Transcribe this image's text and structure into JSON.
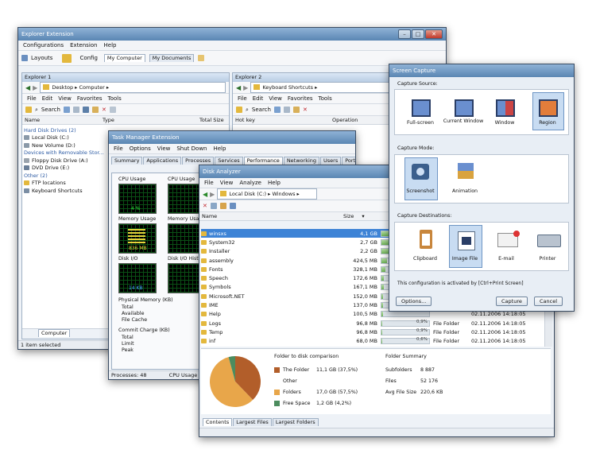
{
  "explorer": {
    "title": "Explorer Extension",
    "menu": [
      "Configurations",
      "Extension",
      "Help"
    ],
    "toolbar": {
      "layouts": "Layouts",
      "config": "Config",
      "tabs": [
        "My Computer",
        "My Documents"
      ]
    },
    "pane1": {
      "title": "Explorer 1",
      "address": "Desktop ▸ Computer ▸",
      "menu": [
        "File",
        "Edit",
        "View",
        "Favorites",
        "Tools"
      ],
      "search": "Search",
      "columns": [
        "Name",
        "Type",
        "Total Size"
      ],
      "items": [
        {
          "label": "Hard Disk Drives (2)",
          "kind": "group"
        },
        {
          "label": "Local Disk (C:)",
          "kind": "item"
        },
        {
          "label": "New Volume (D:)",
          "kind": "item"
        },
        {
          "label": "Devices with Removable Stor...",
          "kind": "group"
        },
        {
          "label": "Floppy Disk Drive (A:)",
          "kind": "item"
        },
        {
          "label": "DVD Drive (E:)",
          "kind": "item"
        },
        {
          "label": "Other (2)",
          "kind": "group"
        },
        {
          "label": "FTP locations",
          "kind": "item"
        },
        {
          "label": "Keyboard Shortcuts",
          "kind": "item"
        }
      ],
      "bottom_tab": "Computer"
    },
    "pane2": {
      "title": "Explorer 2",
      "address": "Keyboard Shortcuts ▸",
      "menu": [
        "File",
        "Edit",
        "View",
        "Favorites",
        "Tools"
      ],
      "search": "Search",
      "columns": [
        "Hot key",
        "Operation"
      ]
    },
    "status": "1 item selected"
  },
  "taskmgr": {
    "title": "Task Manager Extension",
    "menu": [
      "File",
      "Options",
      "View",
      "Shut Down",
      "Help"
    ],
    "tabs": [
      "Summary",
      "Applications",
      "Processes",
      "Services",
      "Performance",
      "Networking",
      "Users",
      "Ports"
    ],
    "active_tab": "Performance",
    "cpu_usage_label": "CPU Usage",
    "cpu_history_label": "CPU Usage",
    "cpu_value": "4 %",
    "mem_usage_label": "Memory Usage",
    "mem_history_label": "Memory Usage",
    "mem_value": "836 MB",
    "disk_io_label": "Disk I/O",
    "disk_history_label": "Disk I/O Histo",
    "disk_value": "14 KB",
    "physical_memory_label": "Physical Memory (KB)",
    "physical_rows": [
      "Total",
      "Available",
      "File Cache"
    ],
    "commit_label": "Commit Charge (KB)",
    "commit_rows": [
      "Total",
      "Limit",
      "Peak"
    ],
    "status": [
      "Processes: 48",
      "CPU Usage"
    ]
  },
  "disk": {
    "title": "Disk Analyzer",
    "menu": [
      "File",
      "View",
      "Analyze",
      "Help"
    ],
    "address": "Local Disk (C:) ▸ Windows ▸",
    "columns": [
      "Name",
      "Size"
    ],
    "rows": [
      {
        "name": "winsxs",
        "size": "4,1 GB",
        "pct": 0.92,
        "selected": true
      },
      {
        "name": "System32",
        "size": "2,7 GB",
        "pct": 0.62
      },
      {
        "name": "Installer",
        "size": "2,2 GB",
        "pct": 0.5
      },
      {
        "name": "assembly",
        "size": "424,5 MB",
        "pct": 0.11
      },
      {
        "name": "Fonts",
        "size": "328,1 MB",
        "pct": 0.09
      },
      {
        "name": "Speech",
        "size": "172,6 MB",
        "pct": 0.05
      },
      {
        "name": "Symbols",
        "size": "167,1 MB",
        "pct": 0.05
      },
      {
        "name": "Microsoft.NET",
        "size": "152,0 MB",
        "pct": 0.04
      },
      {
        "name": "IME",
        "size": "137,0 MB",
        "pct": 0.04
      },
      {
        "name": "Help",
        "size": "100,5 MB",
        "pct": 0.03
      },
      {
        "name": "Logs",
        "size": "96,8 MB",
        "pct": 0.02
      },
      {
        "name": "Temp",
        "size": "96,8 MB",
        "pct": 0.02
      },
      {
        "name": "inf",
        "size": "68,0 MB",
        "pct": 0.02
      }
    ],
    "visible_pcts": [
      "0,9%",
      "0,9%",
      "0,6%"
    ],
    "type_col": [
      "File Folder",
      "File Folder",
      "File Folder"
    ],
    "date_col": [
      "02.11.2006 14:18:05",
      "02.11.2006 14:18:05",
      "02.11.2006 14:18:05"
    ],
    "date_rows": [
      "02.11.2006 14:18:05",
      "02.11.2006 14:18:05",
      "02.11.2006 14:18:05",
      "02.11.2006 14:18:05",
      "02.11.2006 14:18:05",
      "02.11.2006 14:18:05",
      "02.11.2006 14:18:05"
    ],
    "comparison_title": "Folder to disk comparison",
    "legend": [
      {
        "label": "The Folder",
        "value": "11,1 GB (37,5%)",
        "color": "#b25e2a"
      },
      {
        "label": "Other Folders",
        "value": "17,0 GB (57,5%)",
        "color": "#e8a64a"
      },
      {
        "label": "Free Space",
        "value": "1,2 GB (4,2%)",
        "color": "#4c8c5e"
      }
    ],
    "summary_title": "Folder Summary",
    "summary": [
      {
        "k": "Subfolders",
        "v": "8 887"
      },
      {
        "k": "Files",
        "v": "52 176"
      },
      {
        "k": "Avg File Size",
        "v": "220,6 KB"
      }
    ],
    "bottom_tabs": [
      "Contents",
      "Largest Files",
      "Largest Folders"
    ]
  },
  "capture": {
    "title": "Screen Capture",
    "source_label": "Capture Source:",
    "sources": [
      "Full-screen",
      "Current Window",
      "Window",
      "Region"
    ],
    "selected_source": "Region",
    "mode_label": "Capture Mode:",
    "modes": [
      "Screenshot",
      "Animation"
    ],
    "selected_mode": "Screenshot",
    "dest_label": "Capture Destinations:",
    "destinations": [
      "Clipboard",
      "Image File",
      "E-mail",
      "Printer"
    ],
    "selected_dest": "Image File",
    "hint": "This configuration is activated by [Ctrl+Print Screen]",
    "options_button": "Options...",
    "capture_button": "Capture",
    "cancel_button": "Cancel"
  }
}
